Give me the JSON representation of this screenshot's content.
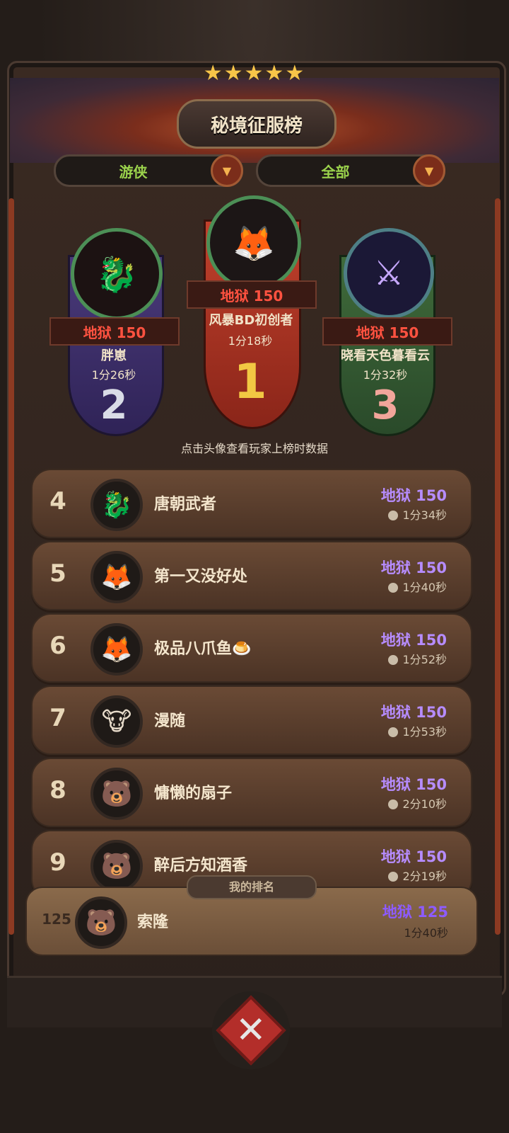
{
  "header": {
    "title": "秘境征服榜",
    "stars": "★★★★★"
  },
  "filters": [
    {
      "label": "游侠",
      "icon": "chevron-down-icon"
    },
    {
      "label": "全部",
      "icon": "chevron-down-icon"
    }
  ],
  "podium": [
    {
      "place": "2",
      "difficulty": "地狱 150",
      "name": "胖崽",
      "time": "1分26秒",
      "avatar": "🐉"
    },
    {
      "place": "1",
      "difficulty": "地狱 150",
      "name": "风暴BD初创者",
      "time": "1分18秒",
      "avatar": "🦊"
    },
    {
      "place": "3",
      "difficulty": "地狱 150",
      "name": "晓看天色暮看云",
      "time": "1分32秒",
      "avatar": "⚔"
    }
  ],
  "hint": "点击头像查看玩家上榜时数据",
  "rows": [
    {
      "rank": "4",
      "name": "唐朝武者",
      "difficulty": "地狱 150",
      "time": "1分34秒",
      "avatar": "🐉"
    },
    {
      "rank": "5",
      "name": "第一又没好处",
      "difficulty": "地狱 150",
      "time": "1分40秒",
      "avatar": "🦊"
    },
    {
      "rank": "6",
      "name": "极品八爪鱼🍮",
      "difficulty": "地狱 150",
      "time": "1分52秒",
      "avatar": "🦊"
    },
    {
      "rank": "7",
      "name": "漫随",
      "difficulty": "地狱 150",
      "time": "1分53秒",
      "avatar": "🐮"
    },
    {
      "rank": "8",
      "name": "慵懒的扇子",
      "difficulty": "地狱 150",
      "time": "2分10秒",
      "avatar": "🐻"
    },
    {
      "rank": "9",
      "name": "醉后方知酒香",
      "difficulty": "地狱 150",
      "time": "2分19秒",
      "avatar": "🐻"
    }
  ],
  "mine": {
    "tag": "我的排名",
    "rank": "125",
    "name": "索隆",
    "difficulty": "地狱 125",
    "time": "1分40秒",
    "avatar": "🐻"
  },
  "colors": {
    "hell_purple": "#b68cff",
    "hell_red": "#ff5240",
    "filter_green": "#9bd34c"
  }
}
